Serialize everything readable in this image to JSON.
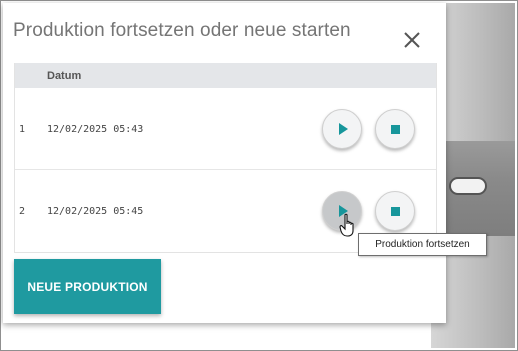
{
  "dialog": {
    "title": "Produktion fortsetzen oder neue starten",
    "close_icon": "close-icon"
  },
  "table": {
    "columns": [
      "",
      "Datum"
    ],
    "rows": [
      {
        "index": "1",
        "date": "12/02/2025 05:43"
      },
      {
        "index": "2",
        "date": "12/02/2025 05:45"
      }
    ]
  },
  "actions": {
    "new_production_label": "NEUE PRODUKTION"
  },
  "tooltip": {
    "text": "Produktion fortsetzen"
  },
  "icons": {
    "play": "play-icon",
    "stop": "stop-icon",
    "cursor": "hand-pointer-icon"
  },
  "colors": {
    "accent": "#1f9aa0",
    "header_bg": "#e4e6e9",
    "title_text": "#757575"
  }
}
